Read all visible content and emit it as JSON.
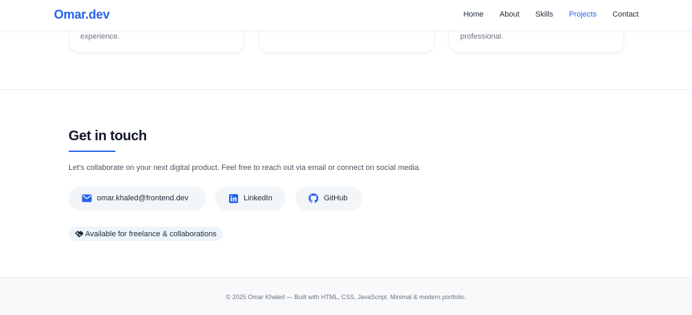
{
  "header": {
    "brand": "Omar.dev",
    "nav": [
      "Home",
      "About",
      "Skills",
      "Projects",
      "Contact"
    ],
    "active_nav": "Projects",
    "accent_color": "#2563eb"
  },
  "cards": [
    {
      "text": "experience."
    },
    {
      "text": ""
    },
    {
      "text": "professional."
    }
  ],
  "contact": {
    "title": "Get in touch",
    "description": "Let's collaborate on your next digital product. Feel free to reach out via email or connect on social media.",
    "links": [
      {
        "label": "omar.khaled@frontend.dev",
        "icon": "envelope-icon"
      },
      {
        "label": "LinkedIn",
        "icon": "linkedin-icon"
      },
      {
        "label": "GitHub",
        "icon": "github-icon"
      }
    ],
    "availability": {
      "label": "Available for freelance & collaborations",
      "icon": "handshake-icon"
    }
  },
  "footer": {
    "text": "© 2025 Omar Khaled — Built with HTML, CSS, JavaScript. Minimal & modern portfolio."
  }
}
